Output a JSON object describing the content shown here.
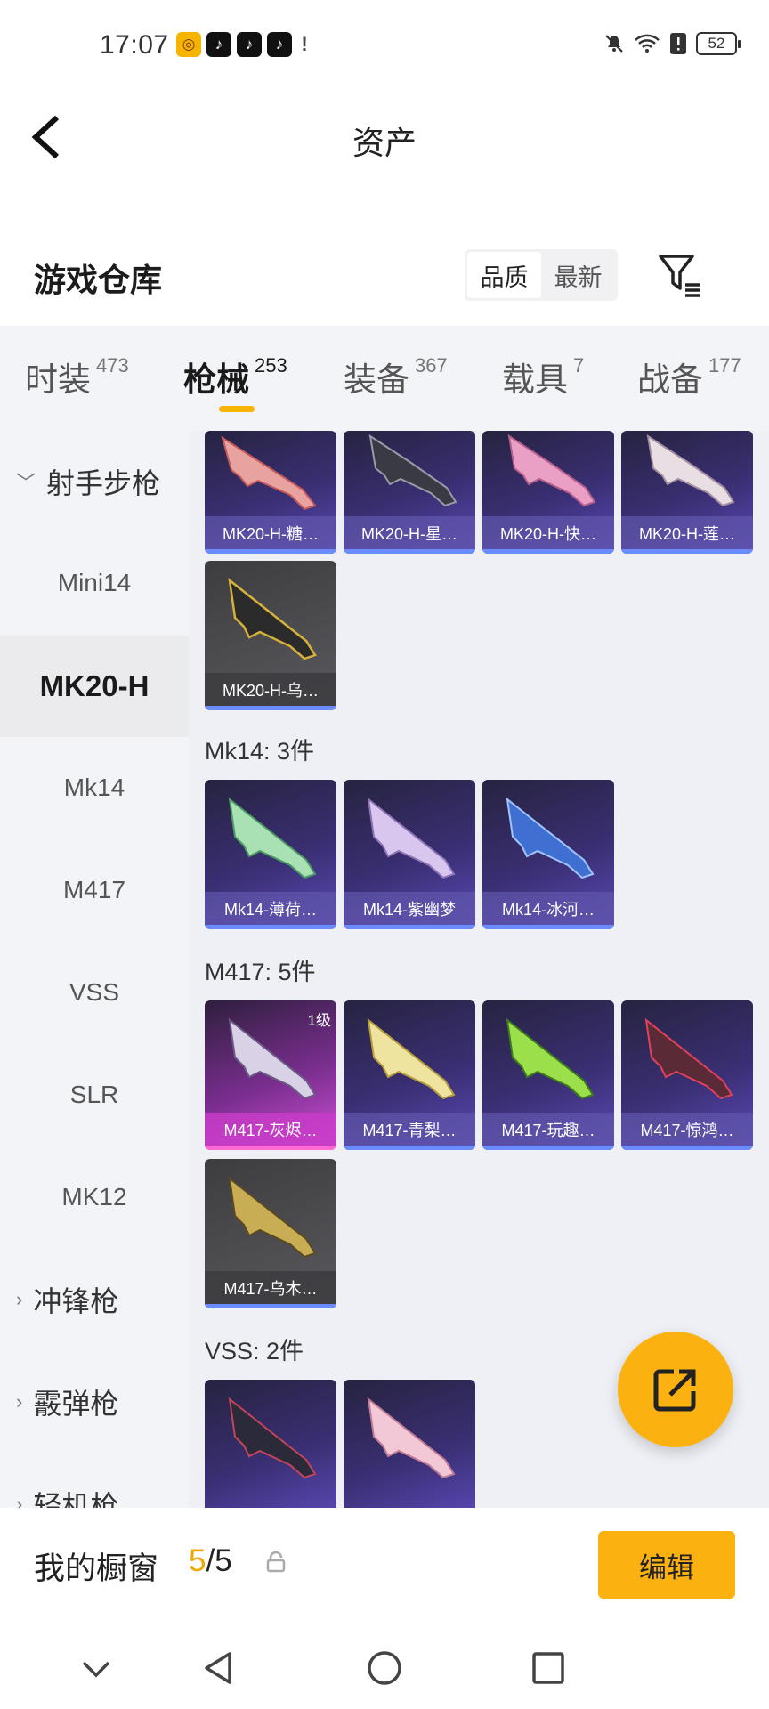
{
  "status_bar": {
    "time": "17:07",
    "battery": "52"
  },
  "header": {
    "title": "资产"
  },
  "section": {
    "title": "游戏仓库",
    "sort_options": [
      "品质",
      "最新"
    ]
  },
  "tabs": [
    {
      "label": "时装",
      "count": "473"
    },
    {
      "label": "枪械",
      "count": "253"
    },
    {
      "label": "装备",
      "count": "367"
    },
    {
      "label": "载具",
      "count": "7"
    },
    {
      "label": "战备",
      "count": "177"
    }
  ],
  "sidebar": {
    "items": [
      {
        "label": "射手步枪",
        "type": "group"
      },
      {
        "label": "Mini14",
        "type": "sub"
      },
      {
        "label": "MK20-H",
        "type": "sub"
      },
      {
        "label": "Mk14",
        "type": "sub"
      },
      {
        "label": "M417",
        "type": "sub"
      },
      {
        "label": "VSS",
        "type": "sub"
      },
      {
        "label": "SLR",
        "type": "sub"
      },
      {
        "label": "MK12",
        "type": "sub"
      },
      {
        "label": "冲锋枪",
        "type": "group"
      },
      {
        "label": "霰弹枪",
        "type": "group"
      },
      {
        "label": "轻机枪",
        "type": "group"
      }
    ]
  },
  "content": {
    "mk20_cards": [
      "MK20-H-糖…",
      "MK20-H-星…",
      "MK20-H-快…",
      "MK20-H-莲…",
      "MK20-H-乌…"
    ],
    "mk14_label": "Mk14: 3件",
    "mk14_cards": [
      "Mk14-薄荷…",
      "Mk14-紫幽梦",
      "Mk14-冰河…"
    ],
    "m417_label": "M417: 5件",
    "m417_cards": [
      "M417-灰烬…",
      "M417-青梨…",
      "M417-玩趣…",
      "M417-惊鸿…",
      "M417-乌木…"
    ],
    "m417_level": "1级",
    "vss_label": "VSS: 2件"
  },
  "bottom": {
    "window_label": "我的橱窗",
    "count_current": "5",
    "count_total": "/5",
    "edit_label": "编辑"
  }
}
